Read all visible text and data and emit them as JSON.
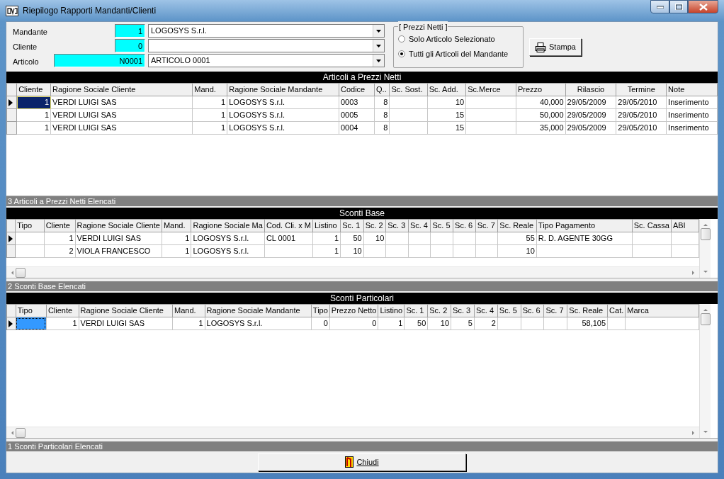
{
  "window": {
    "title": "Riepilogo Rapporti Mandanti/Clienti"
  },
  "filters": [
    {
      "label": "Mandante",
      "code": "1",
      "value": "LOGOSYS S.r.l."
    },
    {
      "label": "Cliente",
      "code": "0"
    },
    {
      "label": "Articolo",
      "code": "N0001",
      "value": "ARTICOLO 0001"
    }
  ],
  "price_option": {
    "legend": "[ Prezzi Netti ]",
    "options": [
      {
        "label": "Solo Articolo Selezionato",
        "selected": false
      },
      {
        "label": "Tutti gli Articoli del Mandante",
        "selected": true
      }
    ]
  },
  "print_button": "Stampa",
  "grids": [
    {
      "title": "Articoli a Prezzi Netti",
      "columns": [
        "Cliente",
        "Ragione Sociale Cliente",
        "Mand.",
        "Ragione Sociale Mandante",
        "Codice",
        "Q..",
        "Sc. Sost.",
        "Sc. Add.",
        "Sc.Merce",
        "Prezzo",
        "Rilascio",
        "Termine",
        "Note"
      ],
      "rows": [
        {
          "selected": true,
          "focused": true,
          "cells": [
            "1",
            "VERDI LUIGI SAS",
            "1",
            "LOGOSYS S.r.l.",
            "0003",
            "8",
            null,
            "10",
            null,
            "40,000",
            "29/05/2009",
            "29/05/2010",
            "Inserimento"
          ]
        },
        {
          "selected": false,
          "focused": false,
          "cells": [
            "1",
            "VERDI LUIGI SAS",
            "1",
            "LOGOSYS S.r.l.",
            "0005",
            "8",
            null,
            "15",
            null,
            "50,000",
            "29/05/2009",
            "29/05/2010",
            "Inserimento"
          ]
        },
        {
          "selected": false,
          "focused": false,
          "cells": [
            "1",
            "VERDI LUIGI SAS",
            "1",
            "LOGOSYS S.r.l.",
            "0004",
            "8",
            null,
            "15",
            null,
            "35,000",
            "29/05/2009",
            "29/05/2010",
            "Inserimento"
          ]
        }
      ],
      "status": "3 Articoli a Prezzi Netti Elencati"
    },
    {
      "title": "Sconti Base",
      "columns": [
        "Tipo",
        "Cliente",
        "Ragione Sociale Cliente",
        "Mand.",
        "Ragione Sociale Ma",
        "Cod. Cli. x M",
        "Listino",
        "Sc. 1",
        "Sc. 2",
        "Sc. 3",
        "Sc. 4",
        "Sc. 5",
        "Sc. 6",
        "Sc. 7",
        "Sc. Reale",
        "Tipo Pagamento",
        "Sc. Cassa",
        "ABI"
      ],
      "rows": [
        {
          "selected": true,
          "focused": false,
          "cells": [
            null,
            "1",
            "VERDI LUIGI SAS",
            "1",
            "LOGOSYS S.r.l.",
            "CL 0001",
            "1",
            "50",
            "10",
            null,
            null,
            null,
            null,
            null,
            "55",
            "R. D. AGENTE 30GG",
            null,
            null
          ]
        },
        {
          "selected": false,
          "focused": false,
          "cells": [
            null,
            "2",
            "VIOLA FRANCESCO",
            "1",
            "LOGOSYS S.r.l.",
            null,
            "1",
            "10",
            null,
            null,
            null,
            null,
            null,
            null,
            "10",
            null,
            null,
            null
          ]
        }
      ],
      "status": "2 Sconti Base Elencati"
    },
    {
      "title": "Sconti Particolari",
      "columns": [
        "Tipo",
        "Cliente",
        "Ragione Sociale Cliente",
        "Mand.",
        "Ragione Sociale Mandante",
        "Tipo",
        "Prezzo Netto",
        "Listino",
        "Sc. 1",
        "Sc. 2",
        "Sc. 3",
        "Sc. 4",
        "Sc. 5",
        "Sc. 6",
        "Sc. 7",
        "Sc. Reale",
        "Cat.",
        "Marca"
      ],
      "rows": [
        {
          "selected": true,
          "focused": true,
          "cells": [
            null,
            "1",
            "VERDI LUIGI SAS",
            "1",
            "LOGOSYS S.r.l.",
            "0",
            "0",
            "1",
            "50",
            "10",
            "5",
            "2",
            null,
            null,
            null,
            "58,105",
            null,
            null
          ]
        }
      ],
      "status": "1 Sconti Particolari Elencati"
    }
  ],
  "close_button": "Chiudi"
}
